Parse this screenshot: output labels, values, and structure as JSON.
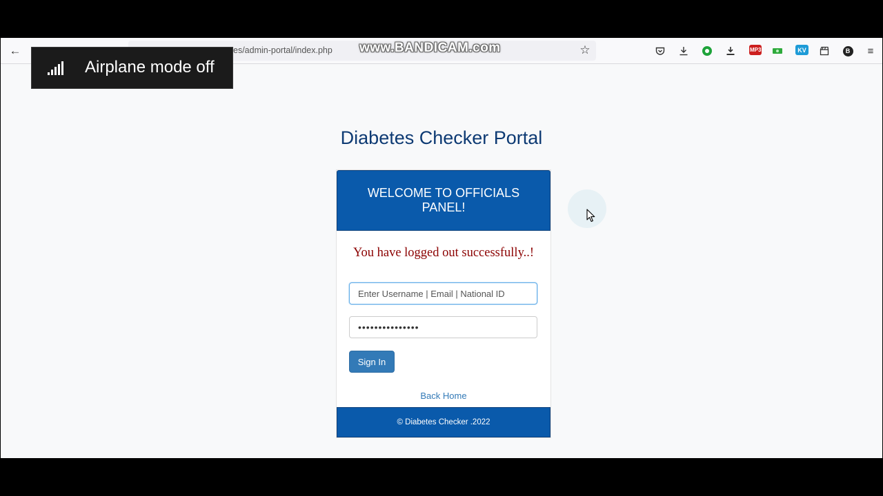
{
  "browser": {
    "url_text": "es/admin-portal/index.php",
    "watermark": "www.BANDICAM.com",
    "extensions": {
      "mp3_label": "MP3",
      "kv_label": "KV",
      "profile_initial": "B"
    }
  },
  "notification": {
    "text": "Airplane mode off"
  },
  "page": {
    "title": "Diabetes Checker Portal",
    "card": {
      "header": "WELCOME TO OFFICIALS PANEL!",
      "message": "You have logged out successfully..!",
      "username_placeholder": "Enter Username | Email | National ID",
      "password_value": "•••••••••••••••",
      "signin_label": "Sign In",
      "back_home_label": "Back Home",
      "footer": "© Diabetes Checker .2022"
    }
  },
  "colors": {
    "brand_blue": "#0a5aab",
    "title_blue": "#0d3a73",
    "message_red": "#8b0000",
    "button_blue": "#337ab7"
  }
}
